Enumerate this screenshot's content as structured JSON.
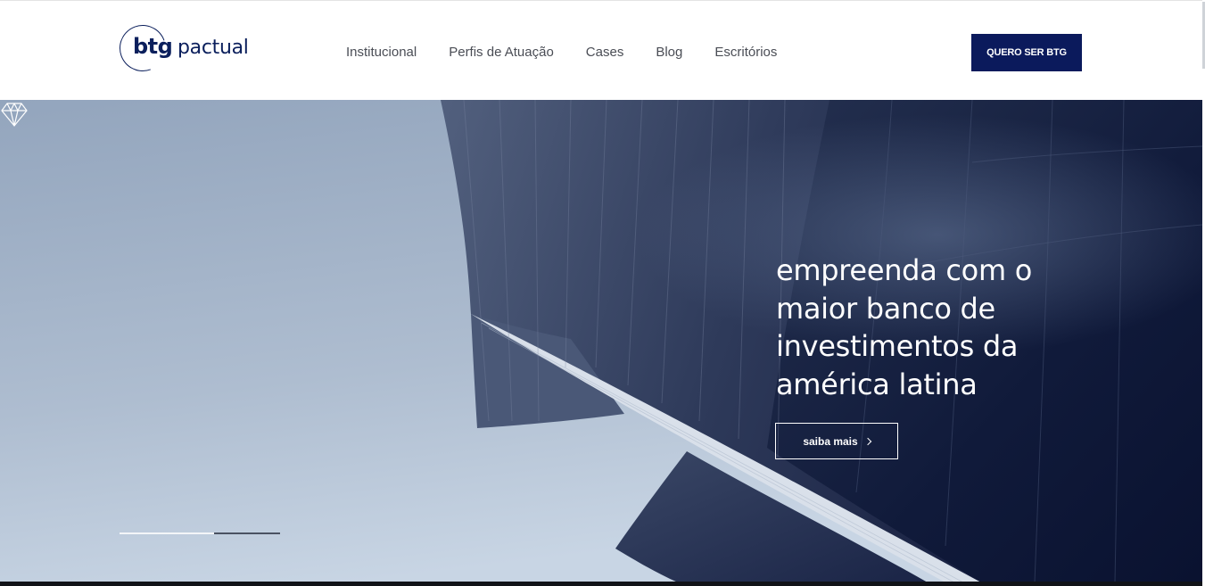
{
  "brand": {
    "logo_primary": "btg",
    "logo_secondary": "pactual",
    "color_navy": "#0b1a5c"
  },
  "nav": {
    "items": [
      {
        "label": "Institucional"
      },
      {
        "label": "Perfis de Atuação"
      },
      {
        "label": "Cases"
      },
      {
        "label": "Blog"
      },
      {
        "label": "Escritórios"
      }
    ]
  },
  "header": {
    "cta_label": "QUERO SER BTG"
  },
  "hero": {
    "headline": "empreenda com o maior banco de investimentos da américa latina",
    "button_label": "saiba mais",
    "button_icon": "chevron-right-icon",
    "badge_icon": "diamond-icon",
    "slides_total": 2,
    "slide_active": 1
  }
}
